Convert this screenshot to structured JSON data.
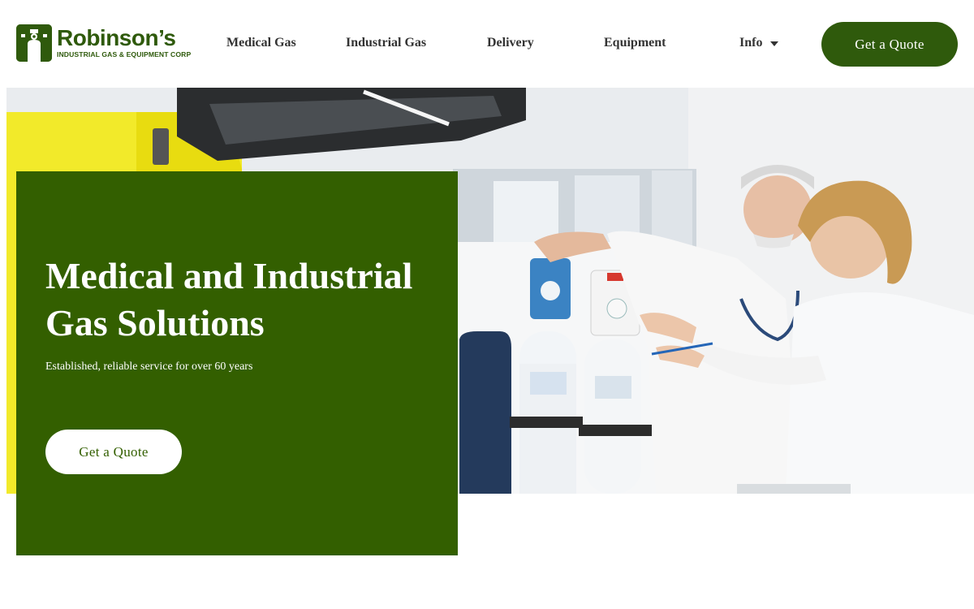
{
  "brand": {
    "name": "Robinson’s",
    "tagline": "INDUSTRIAL GAS & EQUIPMENT CORP",
    "logo_icon": "gas-cylinder-icon",
    "color": "#2f5a0c"
  },
  "nav": {
    "items": [
      {
        "label": "Medical Gas"
      },
      {
        "label": "Industrial Gas"
      },
      {
        "label": "Delivery"
      },
      {
        "label": "Equipment"
      },
      {
        "label": "Info",
        "icon": "caret-down-icon"
      }
    ],
    "cta_label": "Get a Quote"
  },
  "hero": {
    "title": "Medical and Industrial Gas Solutions",
    "subtitle": "Established, reliable service for over 60 years",
    "cta_label": "Get a Quote",
    "card_color": "#335f00",
    "image_description_icon": "hero-photo"
  }
}
